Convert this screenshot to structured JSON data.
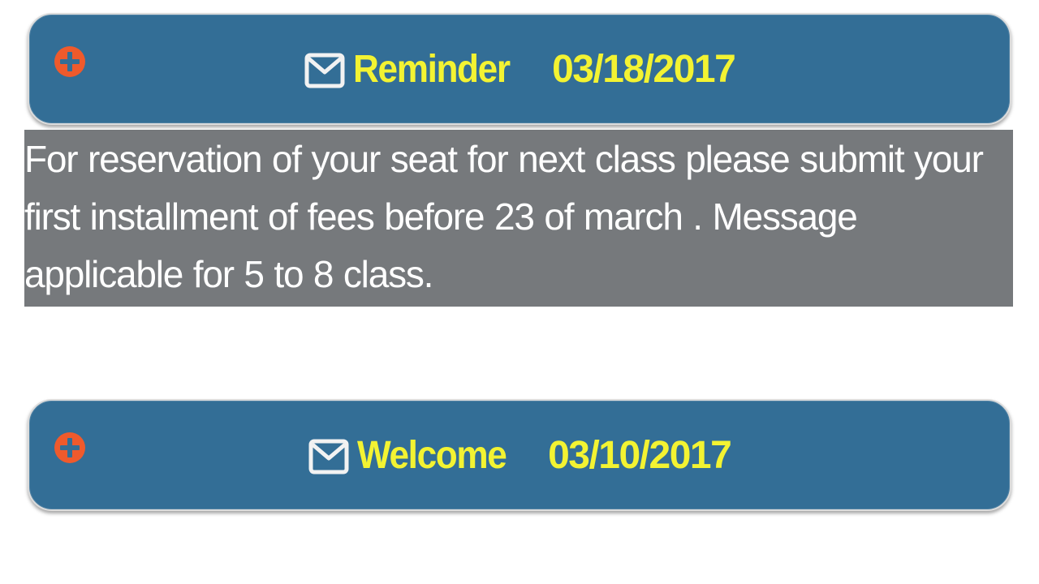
{
  "notices": [
    {
      "title": "Reminder",
      "date": "03/18/2017",
      "message": "For reservation of your seat for next class please submit your first installment of fees before 23 of march . Message applicable for 5 to 8 class.",
      "expanded": true
    },
    {
      "title": "Welcome",
      "date": "03/10/2017",
      "message": "",
      "expanded": false
    }
  ],
  "colors": {
    "header_bg": "#336e96",
    "header_text": "#f3f332",
    "expand_icon": "#ef5a2c",
    "body_bg": "#76797c",
    "body_text": "#ffffff"
  },
  "icons": {
    "expand": "plus-circle-icon",
    "mail": "envelope-icon"
  }
}
